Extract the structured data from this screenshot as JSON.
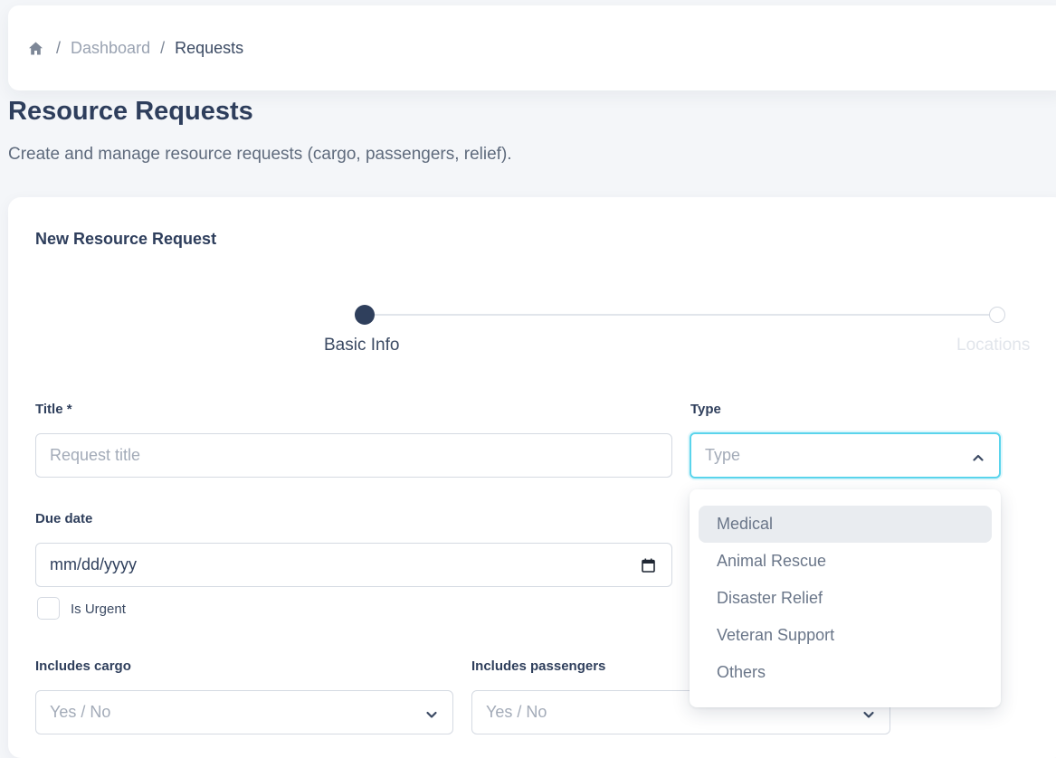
{
  "breadcrumb": {
    "home_icon": "home-icon",
    "separator": "/",
    "items": [
      "Dashboard",
      "Requests"
    ]
  },
  "page": {
    "title": "Resource Requests",
    "subtitle": "Create and manage resource requests (cargo, passengers, relief)."
  },
  "form": {
    "card_title": "New Resource Request",
    "stepper": {
      "steps": [
        "Basic Info",
        "Locations"
      ],
      "active_index": 0
    },
    "title_field": {
      "label": "Title *",
      "placeholder": "Request title",
      "value": ""
    },
    "type_field": {
      "label": "Type",
      "placeholder": "Type",
      "open": true,
      "options": [
        "Medical",
        "Animal Rescue",
        "Disaster Relief",
        "Veteran Support",
        "Others"
      ],
      "highlighted_index": 0
    },
    "due_date": {
      "label": "Due date",
      "display": "mm/dd/yyyy"
    },
    "urgent": {
      "label": "Is Urgent",
      "checked": false
    },
    "includes_cargo": {
      "label": "Includes cargo",
      "placeholder": "Yes / No"
    },
    "includes_passengers": {
      "label": "Includes passengers",
      "placeholder": "Yes / No"
    }
  },
  "colors": {
    "primary": "#2f3f5c",
    "focus_ring": "#5ad4ec",
    "background": "#f4f6f9"
  }
}
